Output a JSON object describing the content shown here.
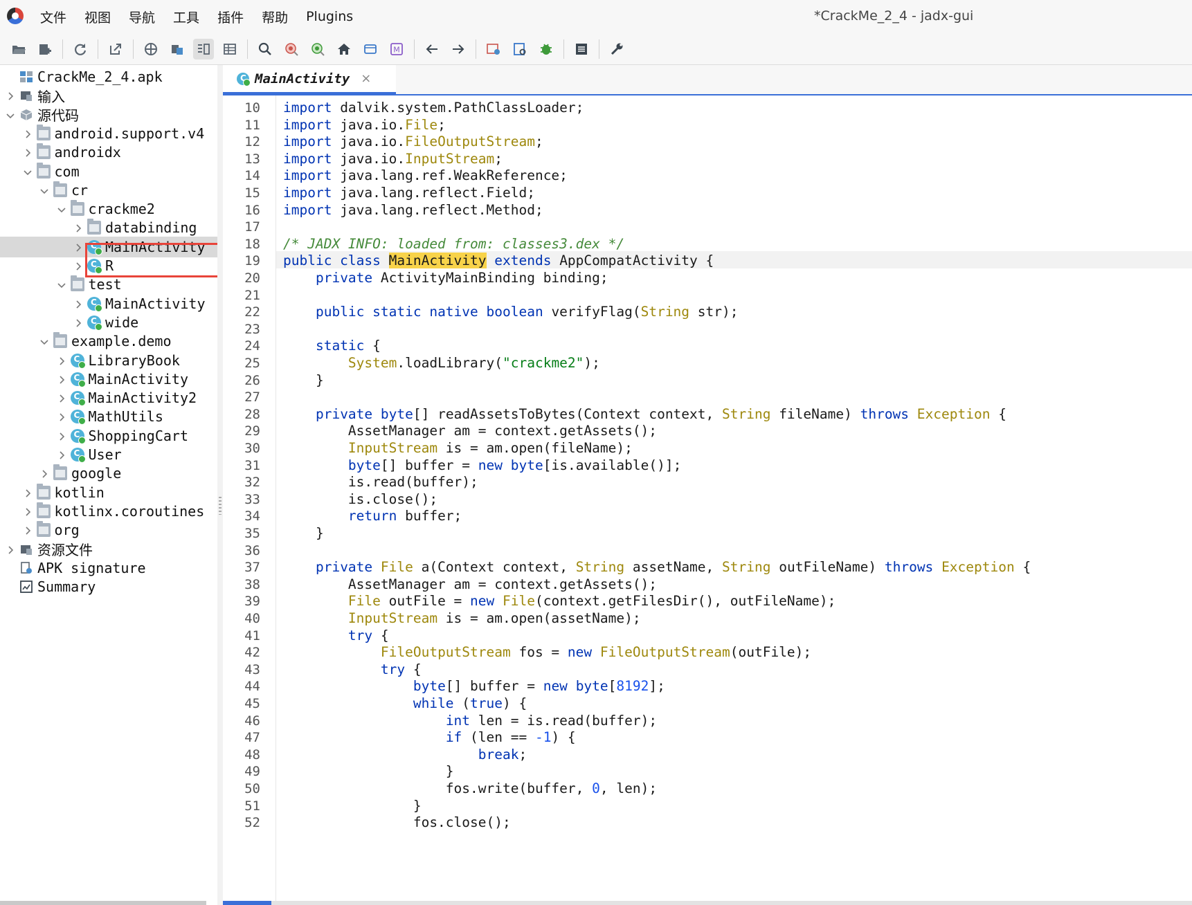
{
  "menu": {
    "items": [
      "文件",
      "视图",
      "导航",
      "工具",
      "插件",
      "帮助",
      "Plugins"
    ],
    "window_title": "*CrackMe_2_4 - jadx-gui"
  },
  "toolbar": {
    "icons": [
      "open-folder-icon",
      "add-files-icon",
      "reload-icon",
      "export-icon",
      "sync-icon",
      "save-all-icon",
      "flatten-packages-icon",
      "table-icon",
      "search-icon",
      "find-class-icon",
      "find-usage-icon",
      "home-icon",
      "window-icon",
      "smali-icon",
      "back-icon",
      "forward-icon",
      "deobfuscation-icon",
      "log-viewer-icon",
      "debug-icon",
      "log-icon",
      "preferences-icon"
    ]
  },
  "tree": {
    "items": [
      {
        "label": "CrackMe_2_4.apk",
        "icon": "apk-icon",
        "level": 0,
        "chevron": "none"
      },
      {
        "label": "输入",
        "icon": "input-icon",
        "level": 0,
        "chevron": "right"
      },
      {
        "label": "源代码",
        "icon": "source-icon",
        "level": 0,
        "chevron": "down"
      },
      {
        "label": "android.support.v4",
        "icon": "package-icon",
        "level": 1,
        "chevron": "right"
      },
      {
        "label": "androidx",
        "icon": "package-icon",
        "level": 1,
        "chevron": "right"
      },
      {
        "label": "com",
        "icon": "package-icon",
        "level": 1,
        "chevron": "down"
      },
      {
        "label": "cr",
        "icon": "package-icon",
        "level": 2,
        "chevron": "down"
      },
      {
        "label": "crackme2",
        "icon": "package-icon",
        "level": 3,
        "chevron": "down"
      },
      {
        "label": "databinding",
        "icon": "package-icon",
        "level": 4,
        "chevron": "right"
      },
      {
        "label": "MainActivity",
        "icon": "class-icon",
        "level": 4,
        "chevron": "right",
        "selected": true
      },
      {
        "label": "R",
        "icon": "class-icon",
        "level": 4,
        "chevron": "right"
      },
      {
        "label": "test",
        "icon": "package-icon",
        "level": 3,
        "chevron": "down"
      },
      {
        "label": "MainActivity",
        "icon": "class-icon",
        "level": 4,
        "chevron": "right"
      },
      {
        "label": "wide",
        "icon": "class-icon",
        "level": 4,
        "chevron": "right"
      },
      {
        "label": "example.demo",
        "icon": "package-icon",
        "level": 2,
        "chevron": "down"
      },
      {
        "label": "LibraryBook",
        "icon": "class-icon",
        "level": 3,
        "chevron": "right"
      },
      {
        "label": "MainActivity",
        "icon": "class-icon",
        "level": 3,
        "chevron": "right"
      },
      {
        "label": "MainActivity2",
        "icon": "class-icon",
        "level": 3,
        "chevron": "right"
      },
      {
        "label": "MathUtils",
        "icon": "class-icon",
        "level": 3,
        "chevron": "right"
      },
      {
        "label": "ShoppingCart",
        "icon": "class-icon",
        "level": 3,
        "chevron": "right"
      },
      {
        "label": "User",
        "icon": "class-icon",
        "level": 3,
        "chevron": "right"
      },
      {
        "label": "google",
        "icon": "package-icon",
        "level": 2,
        "chevron": "right"
      },
      {
        "label": "kotlin",
        "icon": "package-icon",
        "level": 1,
        "chevron": "right"
      },
      {
        "label": "kotlinx.coroutines",
        "icon": "package-icon",
        "level": 1,
        "chevron": "right"
      },
      {
        "label": "org",
        "icon": "package-icon",
        "level": 1,
        "chevron": "right"
      },
      {
        "label": "资源文件",
        "icon": "resources-icon",
        "level": 0,
        "chevron": "right"
      },
      {
        "label": "APK signature",
        "icon": "signature-icon",
        "level": 0,
        "chevron": "none"
      },
      {
        "label": "Summary",
        "icon": "summary-icon",
        "level": 0,
        "chevron": "none"
      }
    ]
  },
  "tab": {
    "label": "MainActivity",
    "close": "×"
  },
  "editor": {
    "lines": [
      {
        "n": "10",
        "tokens": [
          {
            "t": "import",
            "c": "kw"
          },
          {
            "t": " dalvik.system.PathClassLoader;"
          }
        ]
      },
      {
        "n": "11",
        "tokens": [
          {
            "t": "import",
            "c": "kw"
          },
          {
            "t": " java.io."
          },
          {
            "t": "File",
            "c": "ty"
          },
          {
            "t": ";"
          }
        ]
      },
      {
        "n": "12",
        "tokens": [
          {
            "t": "import",
            "c": "kw"
          },
          {
            "t": " java.io."
          },
          {
            "t": "FileOutputStream",
            "c": "ty"
          },
          {
            "t": ";"
          }
        ]
      },
      {
        "n": "13",
        "tokens": [
          {
            "t": "import",
            "c": "kw"
          },
          {
            "t": " java.io."
          },
          {
            "t": "InputStream",
            "c": "ty"
          },
          {
            "t": ";"
          }
        ]
      },
      {
        "n": "14",
        "tokens": [
          {
            "t": "import",
            "c": "kw"
          },
          {
            "t": " java.lang.ref.WeakReference;"
          }
        ]
      },
      {
        "n": "15",
        "tokens": [
          {
            "t": "import",
            "c": "kw"
          },
          {
            "t": " java.lang.reflect.Field;"
          }
        ]
      },
      {
        "n": "16",
        "tokens": [
          {
            "t": "import",
            "c": "kw"
          },
          {
            "t": " java.lang.reflect.Method;"
          }
        ]
      },
      {
        "n": "17",
        "tokens": []
      },
      {
        "n": "18",
        "tokens": [
          {
            "t": "/* JADX INFO: loaded from: classes3.dex */",
            "c": "cm"
          }
        ]
      },
      {
        "n": "19",
        "tokens": [
          {
            "t": "public class ",
            "c": "kw"
          },
          {
            "t": "MainActivity",
            "c": "hl"
          },
          {
            "t": " "
          },
          {
            "t": "extends",
            "c": "kw"
          },
          {
            "t": " AppCompatActivity {"
          }
        ]
      },
      {
        "n": "20",
        "tokens": [
          {
            "t": "    "
          },
          {
            "t": "private",
            "c": "kw"
          },
          {
            "t": " ActivityMainBinding binding;"
          }
        ]
      },
      {
        "n": "21",
        "tokens": []
      },
      {
        "n": "22",
        "tokens": [
          {
            "t": "    "
          },
          {
            "t": "public static native boolean",
            "c": "kw"
          },
          {
            "t": " verifyFlag("
          },
          {
            "t": "String",
            "c": "ty"
          },
          {
            "t": " str);"
          }
        ]
      },
      {
        "n": "23",
        "tokens": []
      },
      {
        "n": "24",
        "tokens": [
          {
            "t": "    "
          },
          {
            "t": "static",
            "c": "kw"
          },
          {
            "t": " {"
          }
        ]
      },
      {
        "n": "25",
        "tokens": [
          {
            "t": "        "
          },
          {
            "t": "System",
            "c": "ty"
          },
          {
            "t": ".loadLibrary("
          },
          {
            "t": "\"crackme2\"",
            "c": "str"
          },
          {
            "t": ");"
          }
        ]
      },
      {
        "n": "26",
        "tokens": [
          {
            "t": "    }"
          }
        ]
      },
      {
        "n": "27",
        "tokens": []
      },
      {
        "n": "28",
        "tokens": [
          {
            "t": "    "
          },
          {
            "t": "private",
            "c": "kw"
          },
          {
            "t": " "
          },
          {
            "t": "byte",
            "c": "kw"
          },
          {
            "t": "[] readAssetsToBytes(Context context, "
          },
          {
            "t": "String",
            "c": "ty"
          },
          {
            "t": " fileName) "
          },
          {
            "t": "throws",
            "c": "kw"
          },
          {
            "t": " "
          },
          {
            "t": "Exception",
            "c": "ty"
          },
          {
            "t": " {"
          }
        ]
      },
      {
        "n": "29",
        "tokens": [
          {
            "t": "        AssetManager am = context.getAssets();"
          }
        ]
      },
      {
        "n": "30",
        "tokens": [
          {
            "t": "        "
          },
          {
            "t": "InputStream",
            "c": "ty"
          },
          {
            "t": " is = am.open(fileName);"
          }
        ]
      },
      {
        "n": "31",
        "tokens": [
          {
            "t": "        "
          },
          {
            "t": "byte",
            "c": "kw"
          },
          {
            "t": "[] buffer = "
          },
          {
            "t": "new",
            "c": "kw"
          },
          {
            "t": " "
          },
          {
            "t": "byte",
            "c": "kw"
          },
          {
            "t": "[is.available()];"
          }
        ]
      },
      {
        "n": "32",
        "tokens": [
          {
            "t": "        is.read(buffer);"
          }
        ]
      },
      {
        "n": "33",
        "tokens": [
          {
            "t": "        is.close();"
          }
        ]
      },
      {
        "n": "34",
        "tokens": [
          {
            "t": "        "
          },
          {
            "t": "return",
            "c": "kw"
          },
          {
            "t": " buffer;"
          }
        ]
      },
      {
        "n": "35",
        "tokens": [
          {
            "t": "    }"
          }
        ]
      },
      {
        "n": "36",
        "tokens": []
      },
      {
        "n": "37",
        "tokens": [
          {
            "t": "    "
          },
          {
            "t": "private",
            "c": "kw"
          },
          {
            "t": " "
          },
          {
            "t": "File",
            "c": "ty"
          },
          {
            "t": " a(Context context, "
          },
          {
            "t": "String",
            "c": "ty"
          },
          {
            "t": " assetName, "
          },
          {
            "t": "String",
            "c": "ty"
          },
          {
            "t": " outFileName) "
          },
          {
            "t": "throws",
            "c": "kw"
          },
          {
            "t": " "
          },
          {
            "t": "Exception",
            "c": "ty"
          },
          {
            "t": " {"
          }
        ]
      },
      {
        "n": "38",
        "tokens": [
          {
            "t": "        AssetManager am = context.getAssets();"
          }
        ]
      },
      {
        "n": "39",
        "tokens": [
          {
            "t": "        "
          },
          {
            "t": "File",
            "c": "ty"
          },
          {
            "t": " outFile = "
          },
          {
            "t": "new",
            "c": "kw"
          },
          {
            "t": " "
          },
          {
            "t": "File",
            "c": "ty"
          },
          {
            "t": "(context.getFilesDir(), outFileName);"
          }
        ]
      },
      {
        "n": "40",
        "tokens": [
          {
            "t": "        "
          },
          {
            "t": "InputStream",
            "c": "ty"
          },
          {
            "t": " is = am.open(assetName);"
          }
        ]
      },
      {
        "n": "41",
        "tokens": [
          {
            "t": "        "
          },
          {
            "t": "try",
            "c": "kw"
          },
          {
            "t": " {"
          }
        ]
      },
      {
        "n": "42",
        "tokens": [
          {
            "t": "            "
          },
          {
            "t": "FileOutputStream",
            "c": "ty"
          },
          {
            "t": " fos = "
          },
          {
            "t": "new",
            "c": "kw"
          },
          {
            "t": " "
          },
          {
            "t": "FileOutputStream",
            "c": "ty"
          },
          {
            "t": "(outFile);"
          }
        ]
      },
      {
        "n": "43",
        "tokens": [
          {
            "t": "            "
          },
          {
            "t": "try",
            "c": "kw"
          },
          {
            "t": " {"
          }
        ]
      },
      {
        "n": "44",
        "tokens": [
          {
            "t": "                "
          },
          {
            "t": "byte",
            "c": "kw"
          },
          {
            "t": "[] buffer = "
          },
          {
            "t": "new",
            "c": "kw"
          },
          {
            "t": " "
          },
          {
            "t": "byte",
            "c": "kw"
          },
          {
            "t": "["
          },
          {
            "t": "8192",
            "c": "num"
          },
          {
            "t": "];"
          }
        ]
      },
      {
        "n": "45",
        "tokens": [
          {
            "t": "                "
          },
          {
            "t": "while",
            "c": "kw"
          },
          {
            "t": " ("
          },
          {
            "t": "true",
            "c": "kw"
          },
          {
            "t": ") {"
          }
        ]
      },
      {
        "n": "46",
        "tokens": [
          {
            "t": "                    "
          },
          {
            "t": "int",
            "c": "kw"
          },
          {
            "t": " len = is.read(buffer);"
          }
        ]
      },
      {
        "n": "47",
        "tokens": [
          {
            "t": "                    "
          },
          {
            "t": "if",
            "c": "kw"
          },
          {
            "t": " (len == "
          },
          {
            "t": "-1",
            "c": "num"
          },
          {
            "t": ") {"
          }
        ]
      },
      {
        "n": "48",
        "tokens": [
          {
            "t": "                        "
          },
          {
            "t": "break",
            "c": "kw"
          },
          {
            "t": ";"
          }
        ]
      },
      {
        "n": "49",
        "tokens": [
          {
            "t": "                    }"
          }
        ]
      },
      {
        "n": "50",
        "tokens": [
          {
            "t": "                    fos.write(buffer, "
          },
          {
            "t": "0",
            "c": "num"
          },
          {
            "t": ", len);"
          }
        ]
      },
      {
        "n": "51",
        "tokens": [
          {
            "t": "                }"
          }
        ]
      },
      {
        "n": "52",
        "tokens": [
          {
            "t": "                fos.close();"
          }
        ]
      }
    ]
  },
  "colors": {
    "keyword": "#0033b3",
    "type": "#9e880d",
    "string": "#067d17",
    "number": "#1750eb",
    "comment": "#458a3a",
    "highlight": "#f8d34a",
    "callout": "#e8443a",
    "accent": "#3a6fd8"
  }
}
